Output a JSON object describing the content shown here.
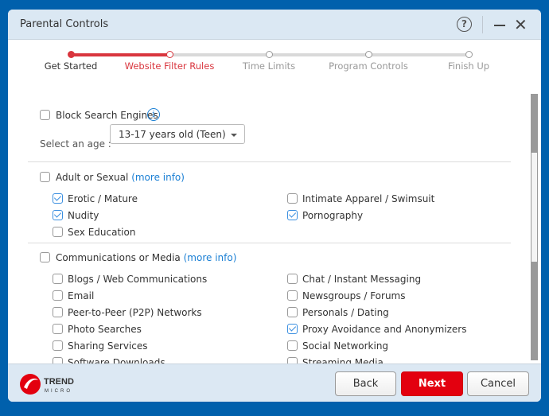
{
  "window": {
    "title": "Parental Controls",
    "help_icon": "question-circle-icon",
    "minimize_icon": "minus-icon",
    "close_icon": "close-icon"
  },
  "steps": [
    {
      "label": "Get Started",
      "state": "done"
    },
    {
      "label": "Website Filter Rules",
      "state": "current"
    },
    {
      "label": "Time Limits",
      "state": "pending"
    },
    {
      "label": "Program Controls",
      "state": "pending"
    },
    {
      "label": "Finish Up",
      "state": "pending"
    }
  ],
  "block_search": {
    "label": "Block Search Engines",
    "checked": false,
    "icon": "info-icon"
  },
  "age": {
    "label": "Select an age :",
    "value": "13-17 years old (Teen)"
  },
  "categories": [
    {
      "label": "Adult or Sexual",
      "more": "(more info)",
      "checked": false,
      "items": [
        {
          "label": "Erotic / Mature",
          "checked": true
        },
        {
          "label": "Intimate Apparel / Swimsuit",
          "checked": false
        },
        {
          "label": "Nudity",
          "checked": true
        },
        {
          "label": "Pornography",
          "checked": true
        },
        {
          "label": "Sex Education",
          "checked": false
        }
      ]
    },
    {
      "label": "Communications or Media",
      "more": "(more info)",
      "checked": false,
      "items": [
        {
          "label": "Blogs / Web Communications",
          "checked": false
        },
        {
          "label": "Chat / Instant Messaging",
          "checked": false
        },
        {
          "label": "Email",
          "checked": false
        },
        {
          "label": "Newsgroups / Forums",
          "checked": false
        },
        {
          "label": "Peer-to-Peer (P2P) Networks",
          "checked": false
        },
        {
          "label": "Personals / Dating",
          "checked": false
        },
        {
          "label": "Photo Searches",
          "checked": false
        },
        {
          "label": "Proxy Avoidance and Anonymizers",
          "checked": true
        },
        {
          "label": "Sharing Services",
          "checked": false
        },
        {
          "label": "Social Networking",
          "checked": false
        },
        {
          "label": "Software Downloads",
          "checked": false
        },
        {
          "label": "Streaming Media",
          "checked": false
        }
      ]
    }
  ],
  "footer": {
    "logo": "TREND MICRO",
    "back": "Back",
    "next": "Next",
    "cancel": "Cancel"
  },
  "colors": {
    "accent": "#d9363e",
    "primary_button": "#e3000f",
    "link": "#1a7fd4",
    "background": "#0060ac"
  }
}
